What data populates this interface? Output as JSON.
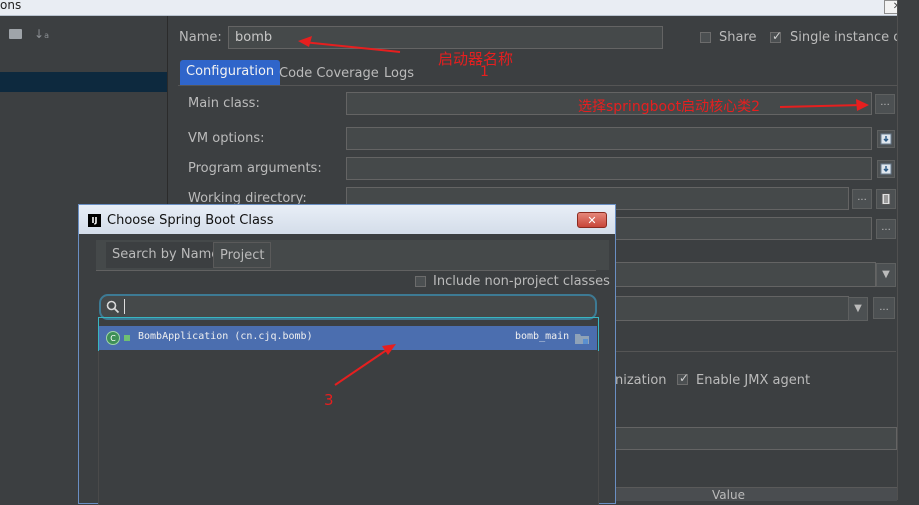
{
  "window": {
    "title_fragment": "ons",
    "close_label": "✕"
  },
  "form": {
    "name_label": "Name:",
    "name_value": "bomb",
    "share_label": "Share",
    "single_instance_label": "Single instance only",
    "tabs": [
      "Configuration",
      "Code Coverage",
      "Logs"
    ],
    "main_class_label": "Main class:",
    "vm_options_label": "VM options:",
    "program_args_label": "Program arguments:",
    "working_dir_label": "Working directory:",
    "ellipsis": "...",
    "fragment_label": "nization",
    "enable_jmx_label": "Enable JMX agent",
    "table_value_header": "Value"
  },
  "annotations": {
    "name_note": "启动器名称",
    "num1": "1",
    "main_class_note": "选择springboot启动核心类2",
    "num3": "3"
  },
  "dialog": {
    "title": "Choose Spring Boot Class",
    "logo": "IJ",
    "close_label": "✕",
    "tabs": [
      "Search by Name",
      "Project"
    ],
    "include_label": "Include non-project classes",
    "search_value": "",
    "results": [
      {
        "class_name": "BombApplication (cn.cjq.bomb)",
        "module": "bomb_main"
      }
    ]
  },
  "colors": {
    "accent": "#2f65ca",
    "annotation_red": "#e61f1f",
    "selection": "#4b6eaf",
    "highlight_box": "#38b6c2"
  }
}
